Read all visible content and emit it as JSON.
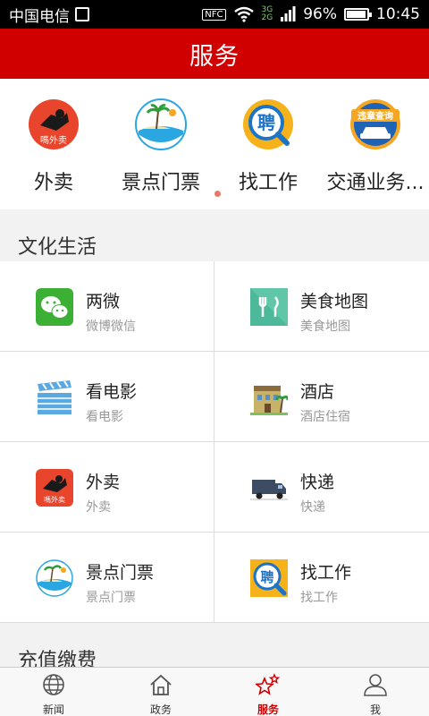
{
  "status_bar": {
    "carrier": "中国电信",
    "network": [
      "3G",
      "2G"
    ],
    "nfc": "NFC",
    "battery": "96%",
    "battery_level": 0.96,
    "time": "10:45"
  },
  "header": {
    "title": "服务"
  },
  "quick_items": [
    {
      "label": "外卖",
      "icon": "takeout-icon"
    },
    {
      "label": "景点门票",
      "icon": "scenic-icon"
    },
    {
      "label": "找工作",
      "icon": "job-icon"
    },
    {
      "label": "交通业务...",
      "icon": "traffic-query-icon"
    }
  ],
  "takeout_logo_text": "嗎外卖",
  "job_logo_text": "聘",
  "traffic_logo_text": "违章查询",
  "section1": {
    "title": "文化生活"
  },
  "services": [
    {
      "name": "两微",
      "sub": "微博微信",
      "icon": "wechat-icon"
    },
    {
      "name": "美食地图",
      "sub": "美食地图",
      "icon": "food-map-icon"
    },
    {
      "name": "看电影",
      "sub": "看电影",
      "icon": "movie-clapper-icon"
    },
    {
      "name": "酒店",
      "sub": "酒店住宿",
      "icon": "hotel-icon"
    },
    {
      "name": "外卖",
      "sub": "外卖",
      "icon": "takeout-icon"
    },
    {
      "name": "快递",
      "sub": "快递",
      "icon": "delivery-truck-icon"
    },
    {
      "name": "景点门票",
      "sub": "景点门票",
      "icon": "scenic-icon"
    },
    {
      "name": "找工作",
      "sub": "找工作",
      "icon": "job-icon"
    }
  ],
  "section2": {
    "title": "充值缴费"
  },
  "tabs": [
    {
      "label": "新闻",
      "icon": "globe-icon",
      "active": false
    },
    {
      "label": "政务",
      "icon": "home-icon",
      "active": false
    },
    {
      "label": "服务",
      "icon": "stars-icon",
      "active": true
    },
    {
      "label": "我",
      "icon": "user-icon",
      "active": false
    }
  ],
  "colors": {
    "brand": "#d10000",
    "dot": "#e8796a"
  }
}
